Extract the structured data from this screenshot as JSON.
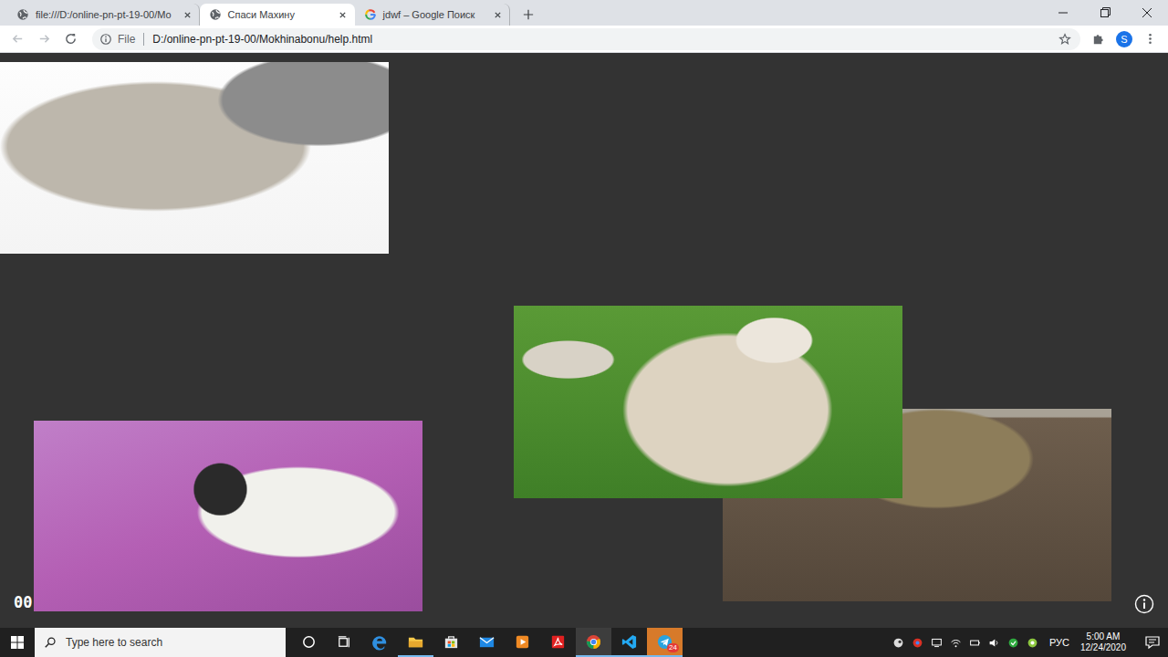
{
  "tabs": [
    {
      "label": "file:///D:/online-pn-pt-19-00/Mo",
      "kind": "file",
      "selected": false
    },
    {
      "label": "Спаси Махину",
      "kind": "file",
      "selected": true
    },
    {
      "label": "jdwf – Google Поиск",
      "kind": "google",
      "selected": false
    }
  ],
  "address_bar": {
    "scheme_label": "File",
    "url": "D:/online-pn-pt-19-00/Mokhinabonu/help.html"
  },
  "profile": {
    "initial": "S"
  },
  "page": {
    "counter": "00"
  },
  "taskbar": {
    "search_placeholder": "Type here to search",
    "apps": [
      {
        "kind": "cortana",
        "open": false,
        "active": false,
        "flashing": false,
        "badge": ""
      },
      {
        "kind": "taskview",
        "open": false,
        "active": false,
        "flashing": false,
        "badge": ""
      },
      {
        "kind": "edge",
        "open": false,
        "active": false,
        "flashing": false,
        "badge": ""
      },
      {
        "kind": "explorer",
        "open": true,
        "active": false,
        "flashing": false,
        "badge": ""
      },
      {
        "kind": "store",
        "open": false,
        "active": false,
        "flashing": false,
        "badge": ""
      },
      {
        "kind": "mail",
        "open": false,
        "active": false,
        "flashing": false,
        "badge": ""
      },
      {
        "kind": "media",
        "open": false,
        "active": false,
        "flashing": false,
        "badge": ""
      },
      {
        "kind": "acrobat",
        "open": false,
        "active": false,
        "flashing": false,
        "badge": ""
      },
      {
        "kind": "chrome",
        "open": true,
        "active": true,
        "flashing": false,
        "badge": ""
      },
      {
        "kind": "vscode",
        "open": true,
        "active": false,
        "flashing": false,
        "badge": ""
      },
      {
        "kind": "telegram",
        "open": true,
        "active": false,
        "flashing": true,
        "badge": "24"
      }
    ],
    "language": "РУС",
    "time": "5:00 AM",
    "date": "12/24/2020"
  }
}
